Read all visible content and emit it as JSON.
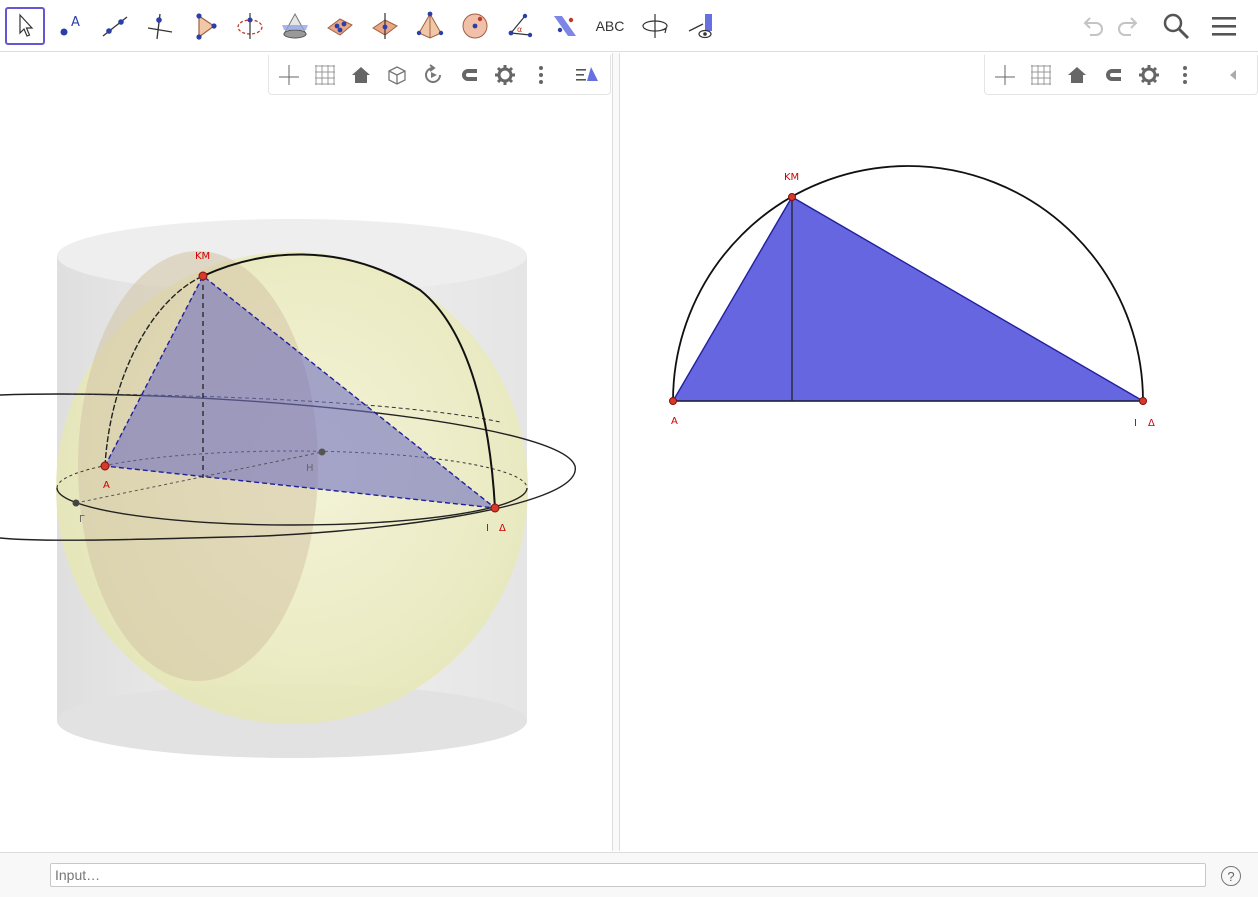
{
  "toolbar": {
    "tools": [
      {
        "icon": "move-arrow-icon",
        "active": true
      },
      {
        "icon": "point-icon"
      },
      {
        "icon": "line-icon"
      },
      {
        "icon": "perpendicular-line-icon"
      },
      {
        "icon": "polygon-icon"
      },
      {
        "icon": "circle-with-axis-icon"
      },
      {
        "icon": "intersect-surfaces-icon"
      },
      {
        "icon": "plane-through-points-icon"
      },
      {
        "icon": "perpendicular-plane-icon"
      },
      {
        "icon": "pyramid-icon"
      },
      {
        "icon": "sphere-icon"
      },
      {
        "icon": "angle-icon"
      },
      {
        "icon": "reflect-about-plane-icon"
      },
      {
        "icon": "text-icon",
        "label": "ABC"
      },
      {
        "icon": "rotate-view-icon"
      },
      {
        "icon": "view-toward-icon"
      }
    ],
    "undo_icon": "undo-icon",
    "redo_icon": "redo-icon",
    "search_icon": "search-icon",
    "menu_icon": "menu-icon"
  },
  "view3d": {
    "stylebar_icons": [
      "axes-icon",
      "grid-icon",
      "home-icon",
      "cube-view-icon",
      "rotate-icon",
      "magnet-icon",
      "gear-icon",
      "more-icon",
      "projection-icon"
    ],
    "labels": {
      "km": "ΚΜ",
      "a": "Α",
      "h": "Η",
      "g": "Γ",
      "i": "Ι",
      "d": "Δ"
    }
  },
  "view2d": {
    "stylebar_icons": [
      "axes-icon",
      "grid-icon",
      "home-icon",
      "magnet-icon",
      "gear-icon",
      "more-icon",
      "collapse-icon"
    ],
    "labels": {
      "km": "ΚΜ",
      "a": "Α",
      "i": "Ι",
      "d": "Δ"
    }
  },
  "inputbar": {
    "placeholder": "Input…",
    "help": "?"
  },
  "colors": {
    "accent": "#6557d2",
    "triangle_fill": "#6666e0",
    "point": "#d83a2a",
    "label": "#cc0000",
    "sphere": "#f0f0c0"
  }
}
